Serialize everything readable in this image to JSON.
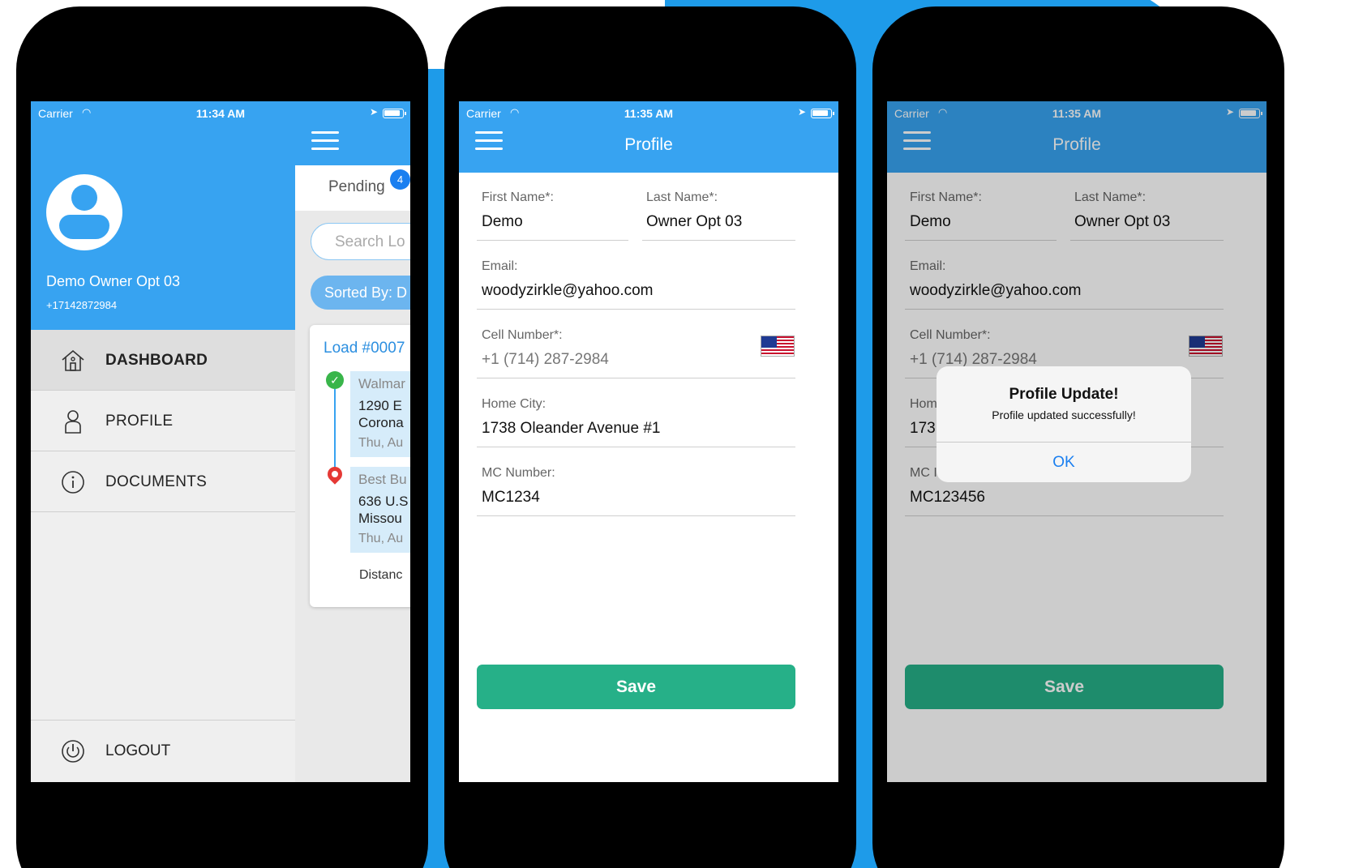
{
  "status_bar": {
    "carrier": "Carrier",
    "time_drawer": "11:34 AM",
    "time_profile": "11:35 AM"
  },
  "drawer": {
    "user_name": "Demo Owner Opt 03",
    "user_phone": "+17142872984",
    "menu": {
      "dashboard": "DASHBOARD",
      "profile": "PROFILE",
      "documents": "DOCUMENTS",
      "logout": "LOGOUT"
    }
  },
  "dashboard_peek": {
    "tab_label": "Pending",
    "badge_count": "4",
    "search_placeholder": "Search Lo",
    "sorted_by": "Sorted By: D",
    "load_id": "Load #0007",
    "pickup": {
      "name": "Walmar",
      "address1": "1290 E",
      "address2": "Corona",
      "date": "Thu, Au"
    },
    "dropoff": {
      "name": "Best Bu",
      "address1": "636 U.S",
      "address2": "Missou",
      "date": "Thu, Au"
    },
    "distance": "Distanc"
  },
  "profile": {
    "title": "Profile",
    "first_name_label": "First Name*:",
    "first_name": "Demo",
    "last_name_label": "Last Name*:",
    "last_name": "Owner Opt 03",
    "email_label": "Email:",
    "email": "woodyzirkle@yahoo.com",
    "cell_label": "Cell Number*:",
    "cell": "+1 (714) 287-2984",
    "home_city_label": "Home City:",
    "home_city": "1738 Oleander Avenue #1",
    "mc_label": "MC Number:",
    "mc_number": "MC1234",
    "save_label": "Save"
  },
  "profile_alert_screen": {
    "home_city_label_partial": "Hom",
    "home_city_partial": "173",
    "mc_label_partial": "MC I",
    "mc_number_partial": "MC123456"
  },
  "alert": {
    "title": "Profile Update!",
    "message": "Profile updated successfully!",
    "ok_label": "OK"
  },
  "colors": {
    "brand_blue": "#37a3f1",
    "background_blue": "#1e9be9",
    "save_green": "#26b088",
    "link_blue": "#1a7ff0"
  }
}
